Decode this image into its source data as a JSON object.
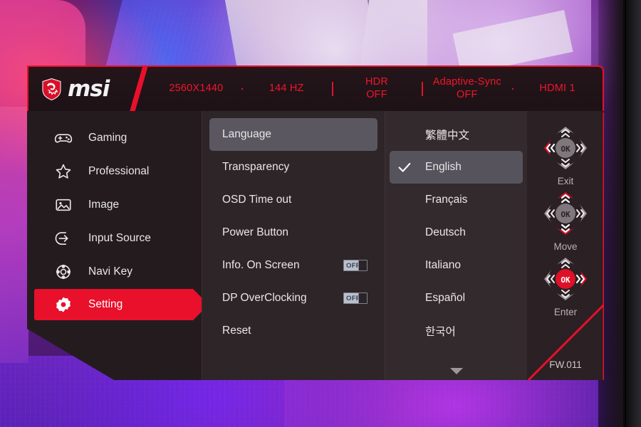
{
  "brand": {
    "logo_icon": "msi-dragon-shield-icon",
    "wordmark": "msi"
  },
  "header": {
    "items": [
      {
        "main": "2560X1440",
        "sub": ""
      },
      {
        "main": "144 HZ",
        "sub": ""
      },
      {
        "main": "HDR",
        "sub": "OFF"
      },
      {
        "main": "Adaptive-Sync",
        "sub": "OFF"
      },
      {
        "main": "HDMI 1",
        "sub": ""
      }
    ],
    "accent_color": "#e8102a"
  },
  "sidebar": {
    "items": [
      {
        "label": "Gaming",
        "icon": "gamepad-icon",
        "active": false
      },
      {
        "label": "Professional",
        "icon": "star-icon",
        "active": false
      },
      {
        "label": "Image",
        "icon": "picture-icon",
        "active": false
      },
      {
        "label": "Input Source",
        "icon": "input-arrow-icon",
        "active": false
      },
      {
        "label": "Navi Key",
        "icon": "navi-key-icon",
        "active": false
      },
      {
        "label": "Setting",
        "icon": "gear-icon",
        "active": true
      }
    ]
  },
  "submenu": {
    "items": [
      {
        "label": "Language",
        "selected": true,
        "toggle": null
      },
      {
        "label": "Transparency",
        "selected": false,
        "toggle": null
      },
      {
        "label": "OSD Time out",
        "selected": false,
        "toggle": null
      },
      {
        "label": "Power Button",
        "selected": false,
        "toggle": null
      },
      {
        "label": "Info. On Screen",
        "selected": false,
        "toggle": "OFF"
      },
      {
        "label": "DP OverClocking",
        "selected": false,
        "toggle": "OFF"
      },
      {
        "label": "Reset",
        "selected": false,
        "toggle": null
      }
    ]
  },
  "language_list": {
    "items": [
      {
        "label": "繁體中文",
        "selected": false
      },
      {
        "label": "English",
        "selected": true
      },
      {
        "label": "Français",
        "selected": false
      },
      {
        "label": "Deutsch",
        "selected": false
      },
      {
        "label": "Italiano",
        "selected": false
      },
      {
        "label": "Español",
        "selected": false
      },
      {
        "label": "한국어",
        "selected": false
      }
    ],
    "scroll_indicator": "chevron-down-icon"
  },
  "nav_panel": {
    "hints": [
      {
        "label": "Exit",
        "highlight": "left",
        "center_red": false
      },
      {
        "label": "Move",
        "highlight": "updown",
        "center_red": false
      },
      {
        "label": "Enter",
        "highlight": "right",
        "center_red": true
      }
    ],
    "ok_label": "OK",
    "firmware": "FW.011"
  }
}
